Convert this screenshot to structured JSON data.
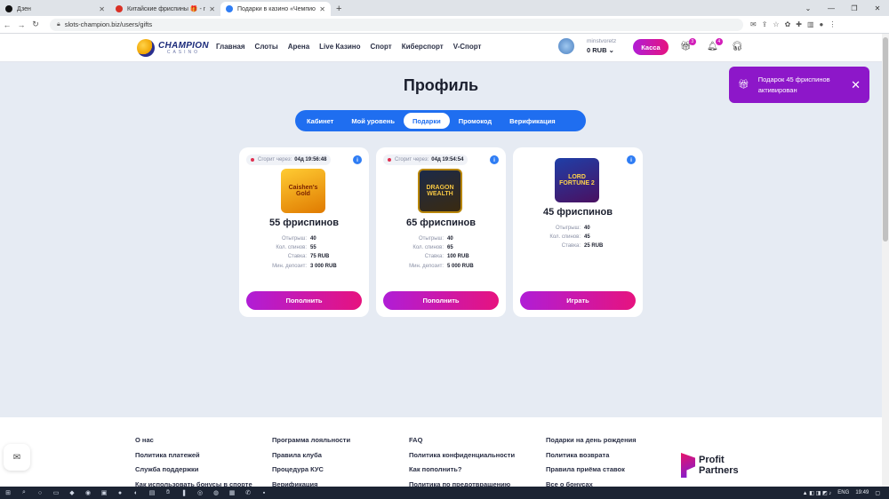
{
  "browser": {
    "tabs": [
      {
        "title": "Дзен",
        "color": "#111111"
      },
      {
        "title": "Китайские фриспины 🎁 - mir...",
        "color": "#d93025"
      },
      {
        "title": "Подарки в казино «Чемпион»",
        "color": "#2f7df4"
      }
    ],
    "url": "slots-champion.biz/users/gifts"
  },
  "header": {
    "logo_main": "CHAMPION",
    "logo_sub": "CASINO",
    "nav": [
      "Главная",
      "Слоты",
      "Арена",
      "Live Казино",
      "Спорт",
      "Киберспорт",
      "V-Спорт"
    ],
    "username": "minstvoretz",
    "balance": "0 RUB",
    "cashier_label": "Касса",
    "gift_badge": "3",
    "bell_badge": "4"
  },
  "toast": {
    "text": "Подарок 45 фриспинов активирован"
  },
  "page": {
    "title": "Профиль",
    "tabs": [
      "Кабинет",
      "Мой уровень",
      "Подарки",
      "Промокод",
      "Верификация"
    ]
  },
  "cards": [
    {
      "timer_label": "Сгорит через:",
      "timer": "04д 19:56:48",
      "game": "Caishen's Gold",
      "game_colors": [
        "#ffcc33",
        "#e07a00"
      ],
      "freespins": "55 фриспинов",
      "stats": [
        {
          "k": "Отыгрыш:",
          "v": "40"
        },
        {
          "k": "Кол. спинов:",
          "v": "55"
        },
        {
          "k": "Ставка:",
          "v": "75 RUB"
        },
        {
          "k": "Мин. депозит:",
          "v": "3 000 RUB"
        }
      ],
      "button": "Пополнить"
    },
    {
      "timer_label": "Сгорит через:",
      "timer": "04д 19:54:54",
      "game": "DRAGON WEALTH",
      "game_colors": [
        "#1c2a48",
        "#b8860b"
      ],
      "freespins": "65 фриспинов",
      "stats": [
        {
          "k": "Отыгрыш:",
          "v": "40"
        },
        {
          "k": "Кол. спинов:",
          "v": "65"
        },
        {
          "k": "Ставка:",
          "v": "100 RUB"
        },
        {
          "k": "Мин. депозит:",
          "v": "5 000 RUB"
        }
      ],
      "button": "Пополнить"
    },
    {
      "game": "LORD FORTUNE 2",
      "game_colors": [
        "#1f3fa8",
        "#c0392b"
      ],
      "freespins": "45 фриспинов",
      "stats": [
        {
          "k": "Отыгрыш:",
          "v": "40"
        },
        {
          "k": "Кол. спинов:",
          "v": "45"
        },
        {
          "k": "Ставка:",
          "v": "25 RUB"
        }
      ],
      "button": "Играть"
    }
  ],
  "footer": {
    "col1": [
      "О нас",
      "Политика платежей",
      "Служба поддержки",
      "Как использовать бонусы в спорте"
    ],
    "col2": [
      "Программа лояльности",
      "Правила клуба",
      "Процедура КУС",
      "Верификация"
    ],
    "col3": [
      "FAQ",
      "Политика конфиденциальности",
      "Как пополнить?",
      "Политика по предотвращению"
    ],
    "col4": [
      "Подарки на день рождения",
      "Политика возврата",
      "Правила приёма ставок",
      "Все о бонусах"
    ],
    "partner_line1": "Profit",
    "partner_line2": "Partners"
  },
  "taskbar": {
    "lang": "ENG",
    "time": "19:49"
  }
}
